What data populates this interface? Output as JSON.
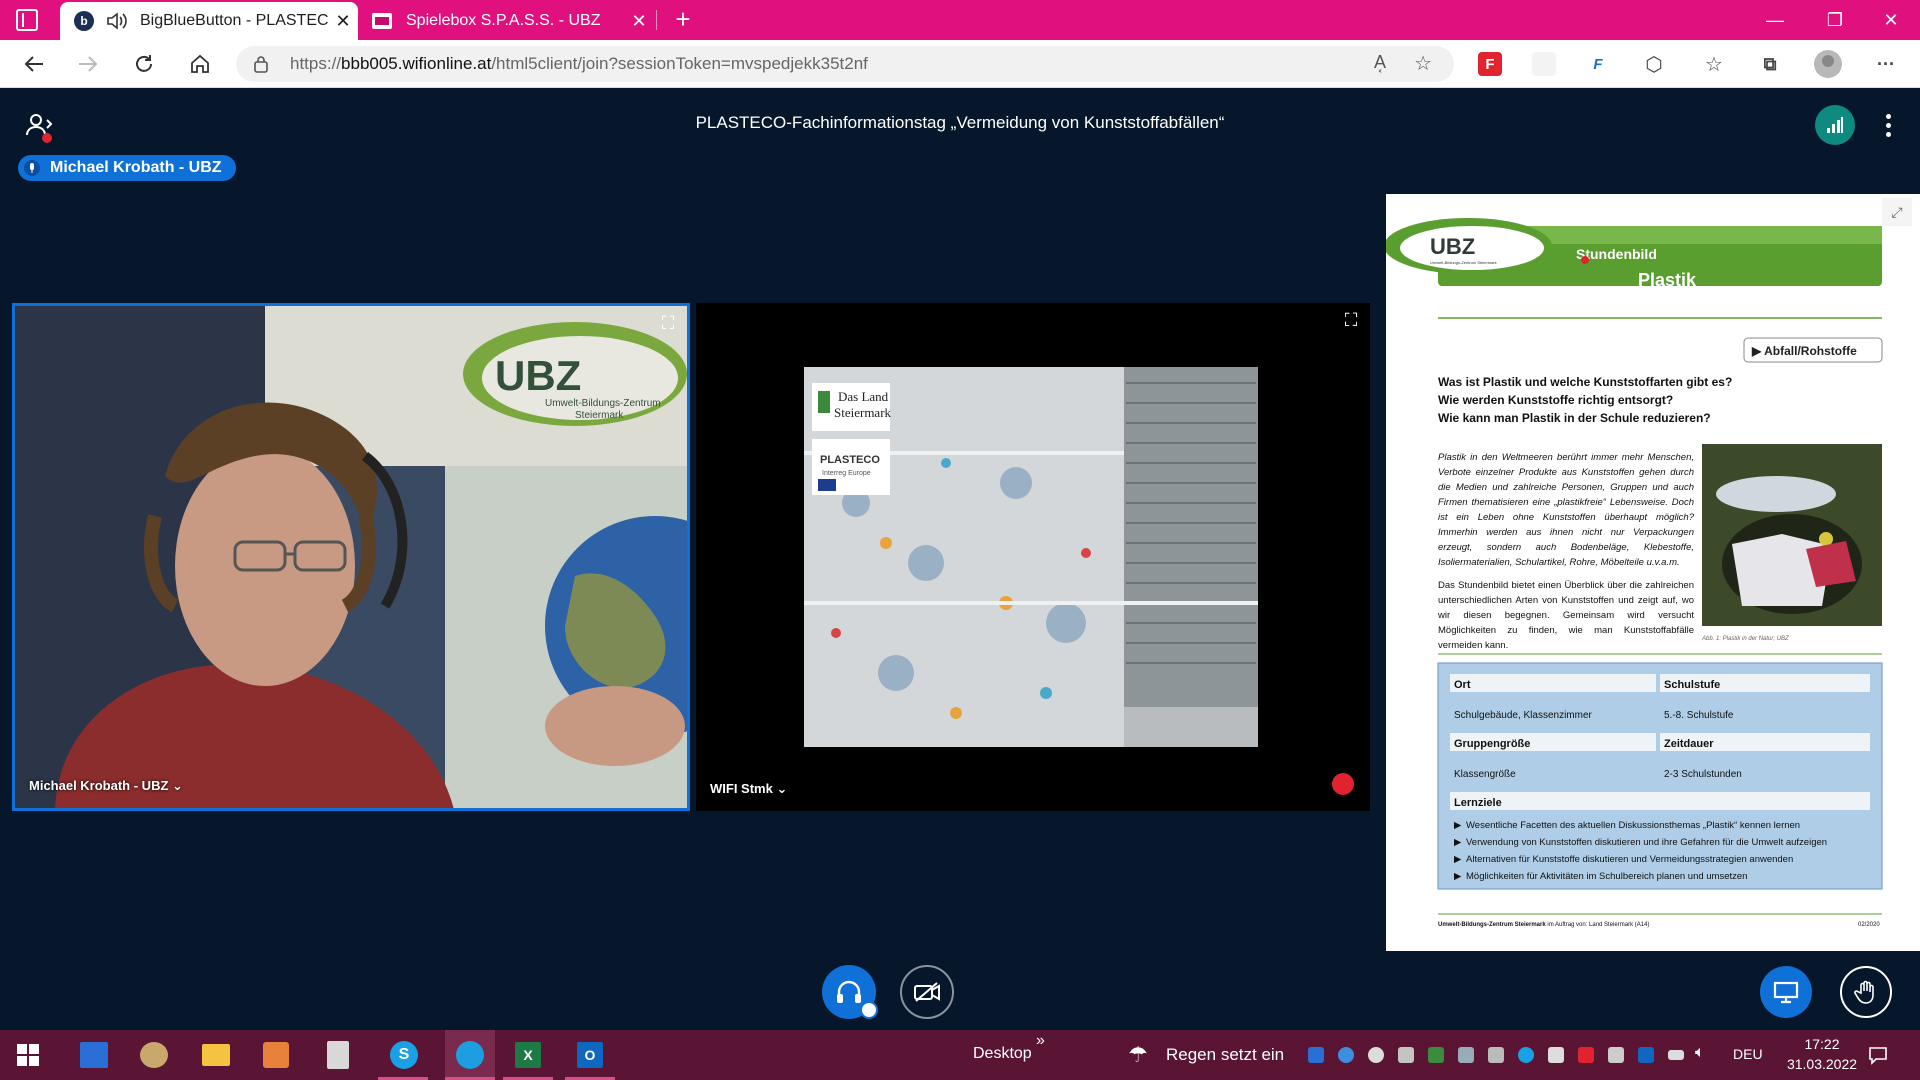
{
  "browser": {
    "tabs": [
      {
        "title": "BigBlueButton - PLASTECO-",
        "favicon": "b",
        "active": true
      },
      {
        "title": "Spielebox S.P.A.S.S. - UBZ",
        "active": false
      }
    ],
    "close_glyph": "✕",
    "new_tab_glyph": "+",
    "window": {
      "minimize": "—",
      "maximize": "❐",
      "close": "✕"
    },
    "url_prefix": "https://",
    "url_host": "bbb005.wifionline.at",
    "url_path": "/html5client/join?sessionToken=mvspedjekk35t2nf",
    "read_aloud": "A͔",
    "more_glyph": "···"
  },
  "meeting": {
    "title": "PLASTECO-Fachinformationstag „Vermeidung von Kunststoffabfällen“",
    "talking_indicator": "Michael Krobath - UBZ"
  },
  "videos": [
    {
      "name": "Michael Krobath - UBZ ⌄",
      "logo_text": "UBZ",
      "logo_sub1": "Umwelt-Bildungs-Zentrum",
      "logo_sub2": "Steiermark"
    },
    {
      "name": "WIFI Stmk ⌄",
      "badge1_line1": "Das Land",
      "badge1_line2": "Steiermark",
      "badge2": "PLASTECO",
      "badge2_sub": "Interreg Europe"
    }
  ],
  "presentation": {
    "logo": "UBZ",
    "logo_sub": "Umwelt-Bildungs-Zentrum Steiermark",
    "header_small": "Stundenbild",
    "header_big": "Plastik",
    "category_button": "▶ Abfall/Rohstoffe",
    "questions": [
      "Was ist Plastik und welche Kunststoffarten gibt es?",
      "Wie werden Kunststoffe richtig entsorgt?",
      "Wie kann man Plastik in der Schule reduzieren?"
    ],
    "intro_italic": "Plastik in den Weltmeeren berührt immer mehr Menschen, Verbote einzelner Produkte aus Kunststoffen gehen durch die Medien und zahlreiche Personen, Gruppen und auch Firmen thematisieren eine „plastikfreie“ Lebensweise. Doch ist ein Leben ohne Kunststoffen überhaupt möglich? Immerhin werden aus ihnen nicht nur Verpackungen erzeugt, sondern auch Bodenbeläge, Klebestoffe, Isoliermaterialien, Schulartikel, Rohre, Möbelteile u.v.a.m.",
    "intro_normal": "Das Stundenbild bietet einen Überblick über die zahlreichen unterschiedlichen Arten von Kunststoffen und zeigt auf, wo wir diesen begegnen. Gemeinsam wird versucht Möglichkeiten zu finden, wie man Kunststoffabfälle vermeiden kann.",
    "photo_caption": "Abb. 1: Plastik in der Natur; UBZ",
    "info": {
      "ort_label": "Ort",
      "ort_value": "Schulgebäude, Klassenzimmer",
      "stufe_label": "Schulstufe",
      "stufe_value": "5.-8. Schulstufe",
      "gruppe_label": "Gruppengröße",
      "gruppe_value": "Klassengröße",
      "dauer_label": "Zeitdauer",
      "dauer_value": "2-3 Schulstunden",
      "lernziele_label": "Lernziele",
      "lernziele": [
        "Wesentliche Facetten des aktuellen Diskussionsthemas „Plastik“ kennen lernen",
        "Verwendung von Kunststoffen diskutieren und ihre Gefahren für die Umwelt aufzeigen",
        "Alternativen für Kunststoffe diskutieren und Vermeidungsstrategien anwenden",
        "Möglichkeiten für Aktivitäten im Schulbereich planen und umsetzen"
      ]
    },
    "footer_bold": "Umwelt-Bildungs-Zentrum Steiermark",
    "footer_rest": " im Auftrag von: Land Steiermark (A14)",
    "footer_date": "02/2020"
  },
  "taskbar": {
    "desktop_label": "Desktop",
    "chevrons": "»",
    "weather": "Regen setzt ein",
    "lang": "DEU",
    "time": "17:22",
    "date": "31.03.2022"
  },
  "colors": {
    "tabstrip": "#e0117f",
    "bbb_bg": "#06172b",
    "bbb_blue": "#0f70d7",
    "taskbar": "#5a1535",
    "ubz_green": "#5a9e2f"
  }
}
